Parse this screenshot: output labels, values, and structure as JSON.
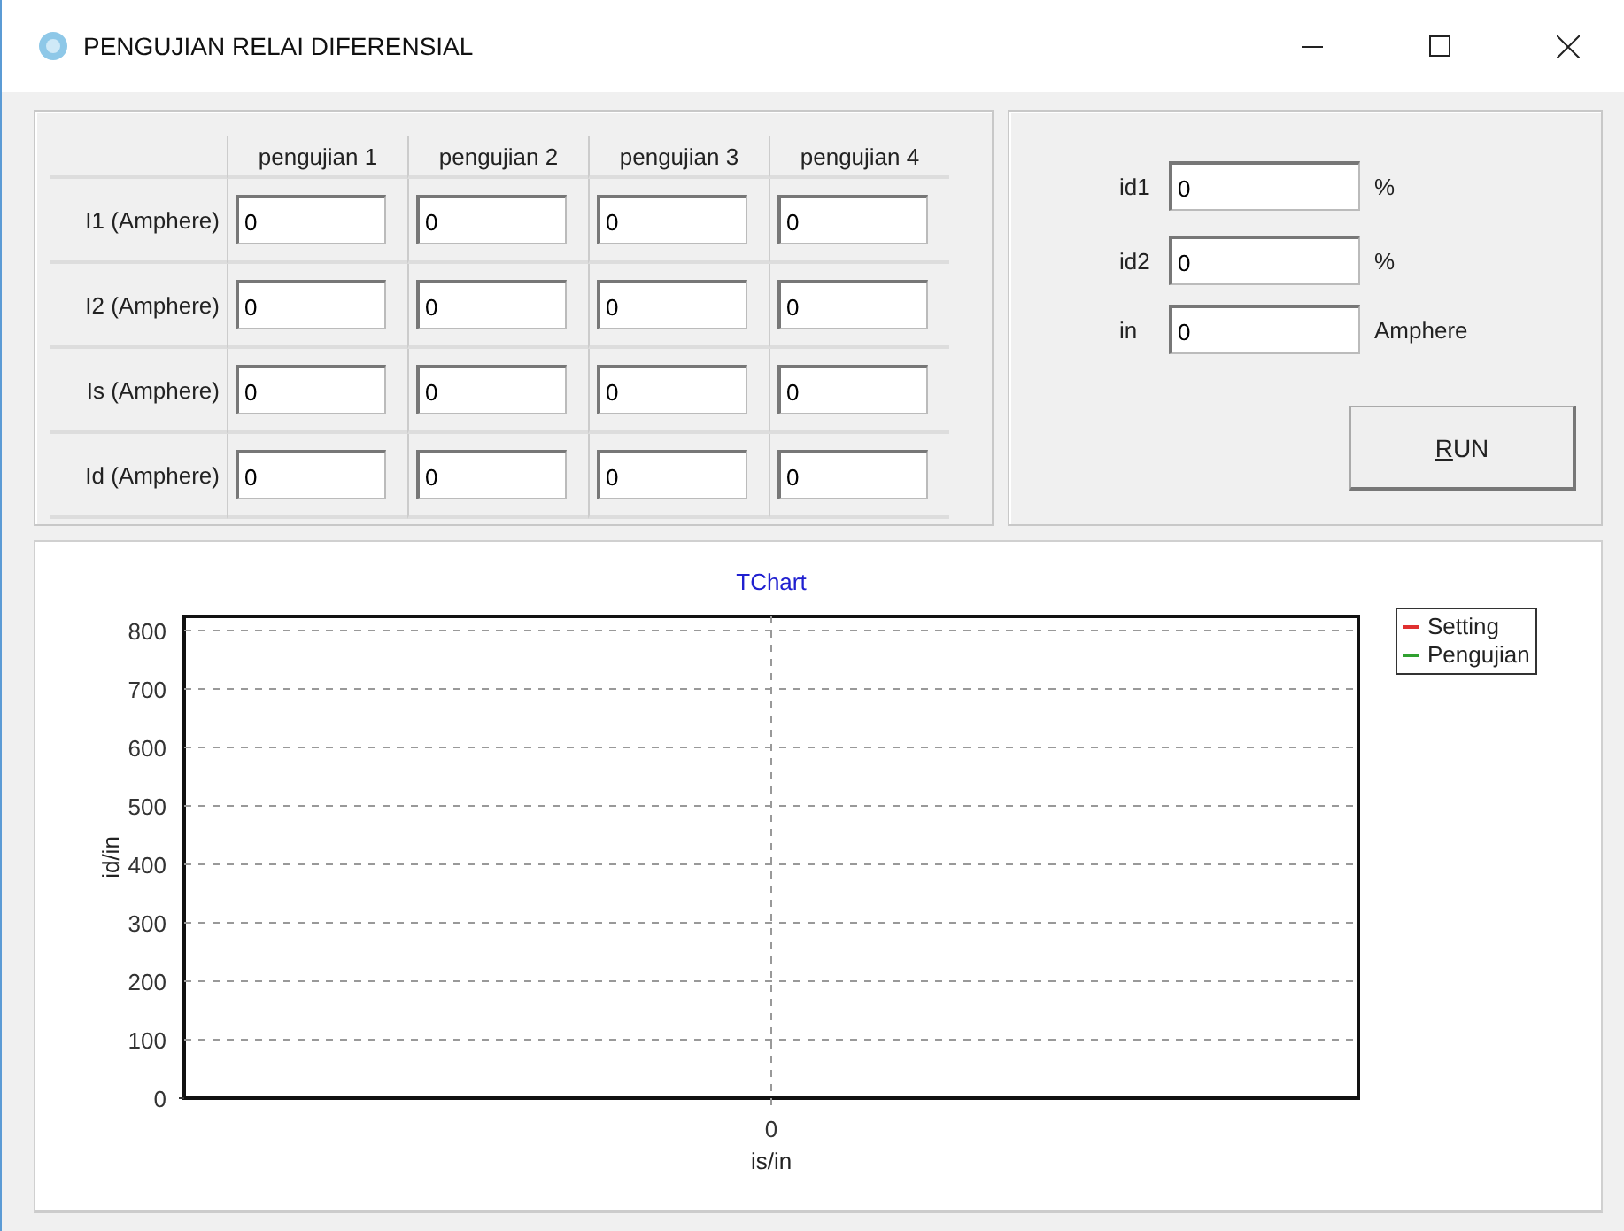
{
  "window": {
    "title": "PENGUJIAN RELAI DIFERENSIAL"
  },
  "test_table": {
    "columns": [
      "pengujian 1",
      "pengujian 2",
      "pengujian 3",
      "pengujian 4"
    ],
    "rows": [
      {
        "label": "I1 (Amphere)",
        "values": [
          "0",
          "0",
          "0",
          "0"
        ]
      },
      {
        "label": "I2 (Amphere)",
        "values": [
          "0",
          "0",
          "0",
          "0"
        ]
      },
      {
        "label": "Is (Amphere)",
        "values": [
          "0",
          "0",
          "0",
          "0"
        ]
      },
      {
        "label": "Id (Amphere)",
        "values": [
          "0",
          "0",
          "0",
          "0"
        ]
      }
    ]
  },
  "settings": {
    "fields": [
      {
        "label": "id1",
        "value": "0",
        "unit": "%"
      },
      {
        "label": "id2",
        "value": "0",
        "unit": "%"
      },
      {
        "label": "in",
        "value": "0",
        "unit": "Amphere"
      }
    ],
    "run_button": {
      "label": "RUN"
    }
  },
  "chart": {
    "chart_data": {
      "type": "line",
      "title": "TChart",
      "xlabel": "is/in",
      "ylabel": "id/in",
      "ylim": [
        0,
        800
      ],
      "yticks": [
        0,
        100,
        200,
        300,
        400,
        500,
        600,
        700,
        800
      ],
      "categories": [
        "0"
      ],
      "grid": true,
      "series": [
        {
          "name": "Setting",
          "color": "#e03030",
          "values": [
            null
          ]
        },
        {
          "name": "Pengujian",
          "color": "#30a030",
          "values": [
            null
          ]
        }
      ]
    }
  }
}
